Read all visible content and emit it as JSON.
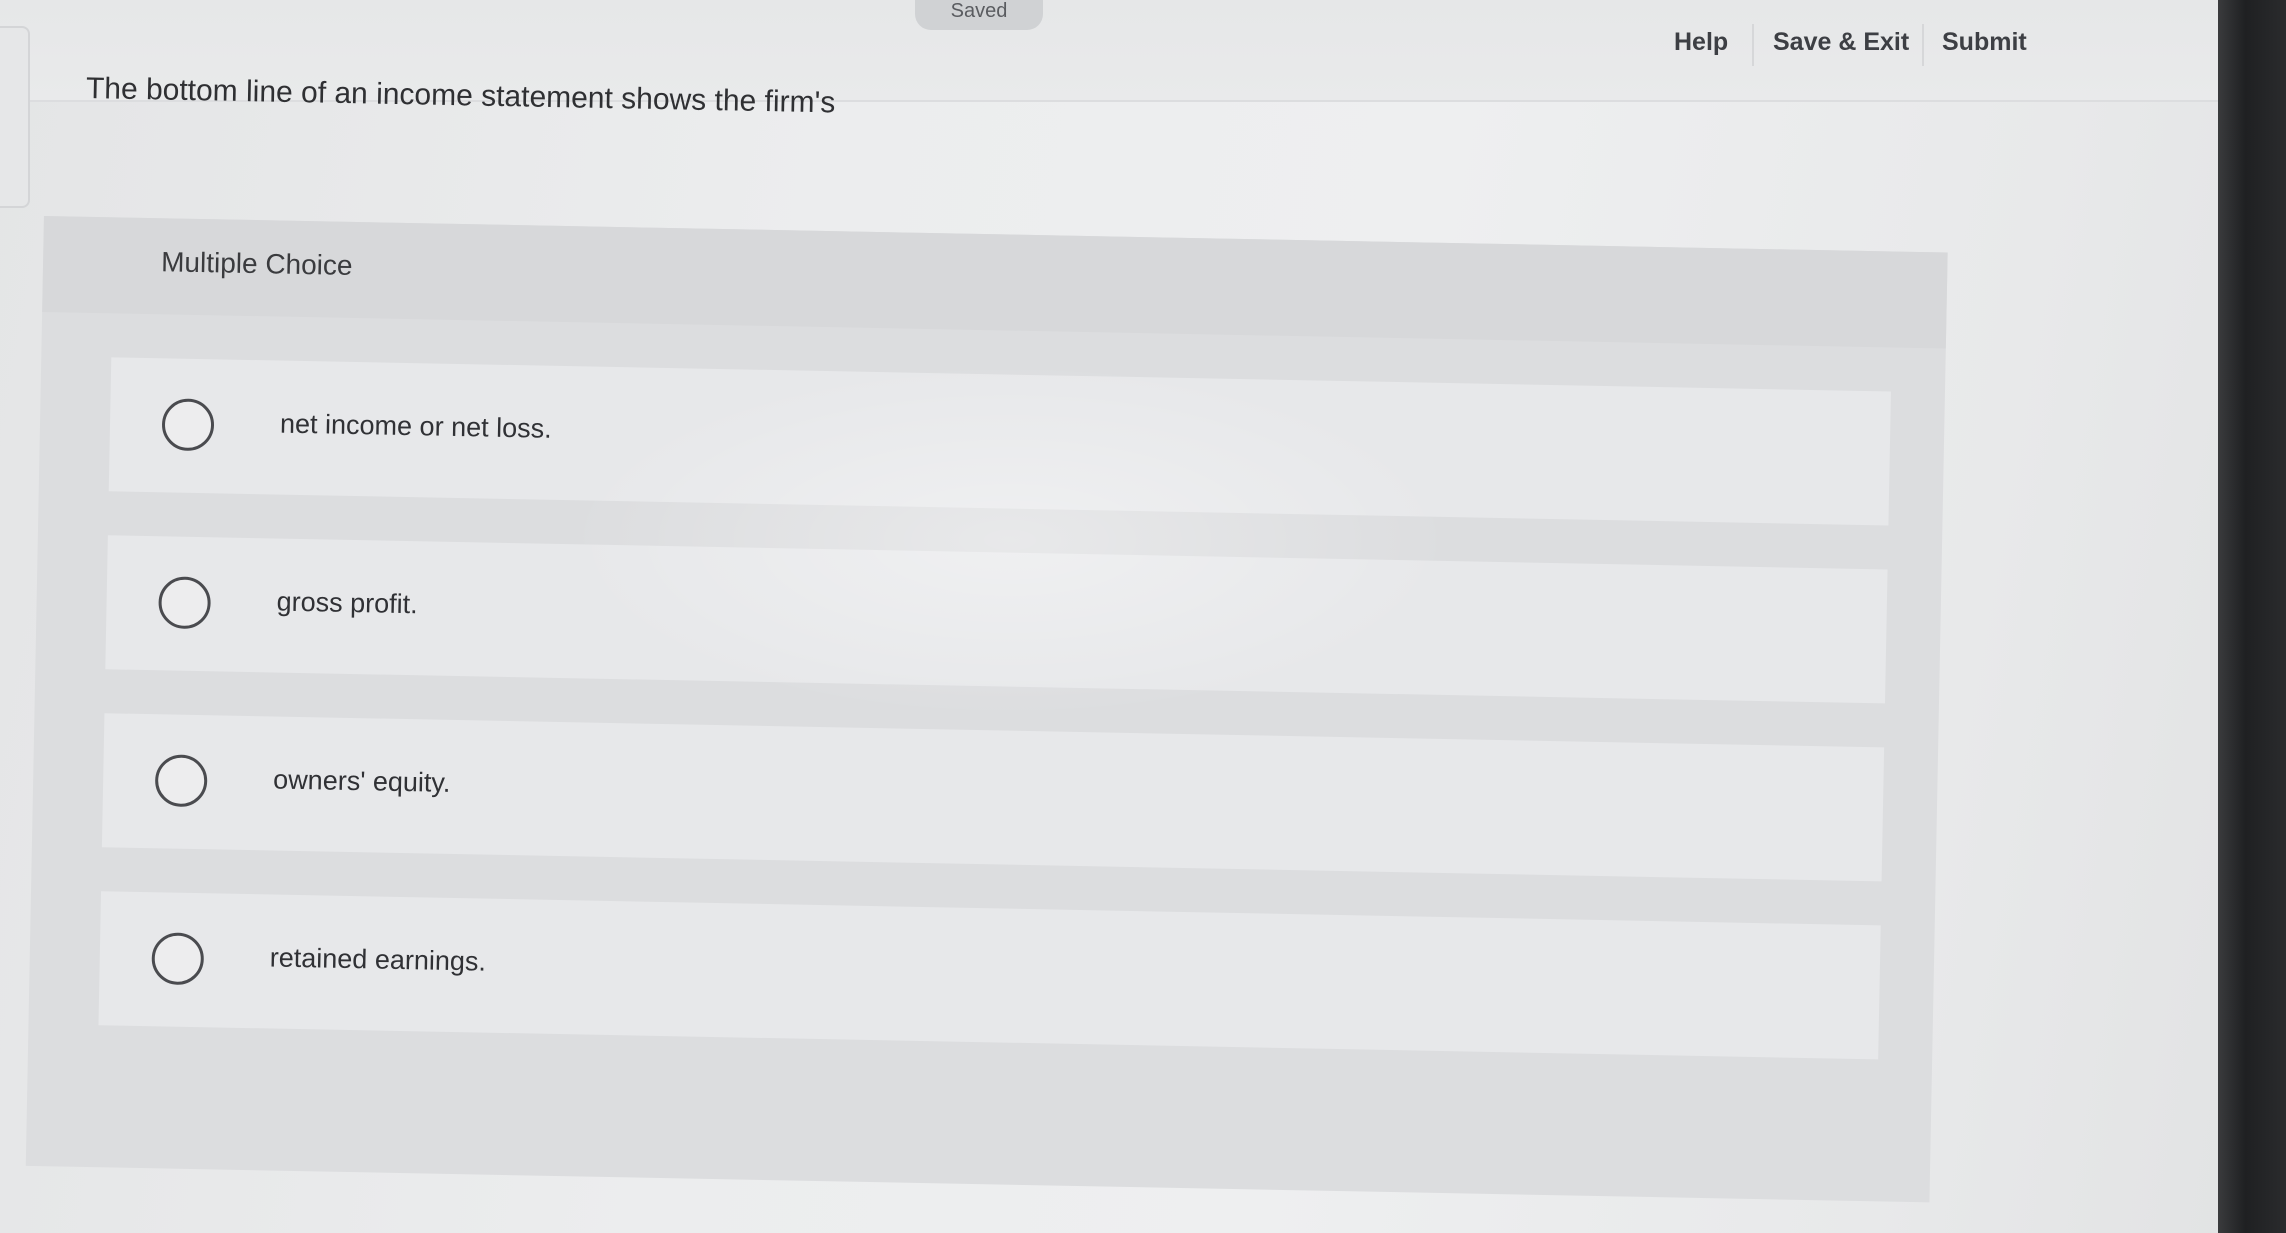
{
  "header": {
    "saved_label": "Saved",
    "nav": {
      "help": "Help",
      "save_exit": "Save & Exit",
      "submit": "Submit"
    }
  },
  "question": {
    "prompt": "The bottom line of an income statement shows the firm's"
  },
  "multiple_choice": {
    "label": "Multiple Choice",
    "options": [
      {
        "text": "net income or net loss.",
        "selected": false
      },
      {
        "text": "gross profit.",
        "selected": false
      },
      {
        "text": "owners' equity.",
        "selected": false
      },
      {
        "text": "retained earnings.",
        "selected": false
      }
    ]
  },
  "colors": {
    "page_background": "#eceded",
    "panel_background": "#dcdddf",
    "option_background": "#e7e8ea",
    "text": "#303135",
    "bezel": "#1f2022"
  }
}
